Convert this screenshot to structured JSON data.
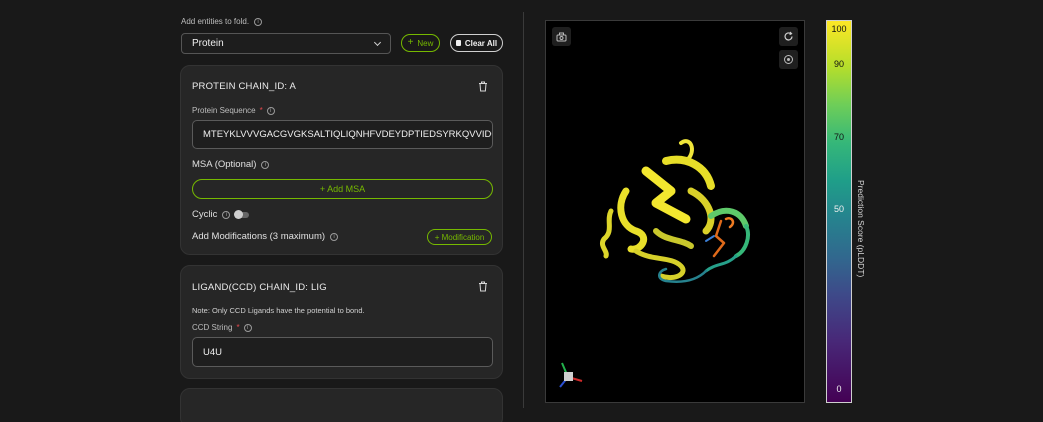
{
  "header": {
    "entities_label": "Add entities to fold.",
    "entity_select_value": "Protein",
    "new_label": "New",
    "clear_all_label": "Clear All"
  },
  "protein_card": {
    "title": "PROTEIN CHAIN_ID: A",
    "sequence_label": "Protein Sequence",
    "required_mark": "*",
    "sequence_value": "MTEYKLVVVGACGVGKSALTIQLIQNHFVDEYDPTIEDSYRKQVVIDGET",
    "msa_label": "MSA (Optional)",
    "add_msa_label": "+ Add MSA",
    "cyclic_label": "Cyclic",
    "modifications_label": "Add Modifications (3 maximum)",
    "modification_button_label": "+ Modification"
  },
  "ligand_card": {
    "title": "LIGAND(CCD) CHAIN_ID: LIG",
    "note": "Note: Only CCD Ligands have the potential to bond.",
    "ccd_label": "CCD String",
    "required_mark": "*",
    "ccd_value": "U4U"
  },
  "colorbar": {
    "ticks": [
      "100",
      "90",
      "70",
      "50",
      "0"
    ],
    "label": "Prediction Score (pLDDT)"
  },
  "colors": {
    "accent_green": "#76b900",
    "background": "#191919",
    "card": "#262626",
    "required_red": "#e5484d"
  },
  "icons": {
    "info": "info-icon",
    "trash": "trash-icon",
    "plus": "plus-icon",
    "refresh": "refresh-icon",
    "center": "target-icon",
    "screenshot": "camera-icon",
    "chevron": "chevron-down-icon"
  }
}
